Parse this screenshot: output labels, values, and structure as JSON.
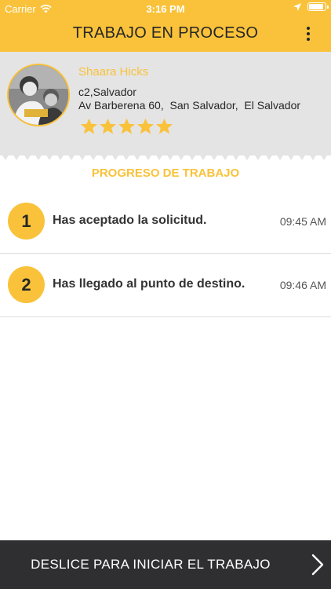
{
  "status_bar": {
    "carrier": "Carrier",
    "time": "3:16 PM"
  },
  "header": {
    "title": "TRABAJO EN PROCESO"
  },
  "profile": {
    "name": "Shaara Hicks",
    "line1": "c2,Salvador",
    "line2": "Av Barberena 60,  San Salvador,  El Salvador",
    "rating": 5
  },
  "progress": {
    "title": "PROGRESO DE TRABAJO",
    "steps": [
      {
        "number": "1",
        "text": "Has aceptado la solicitud.",
        "time": "09:45 AM"
      },
      {
        "number": "2",
        "text": "Has llegado al punto de destino.",
        "time": "09:46 AM"
      }
    ]
  },
  "slider": {
    "label": "DESLICE PARA INICIAR EL TRABAJO"
  },
  "colors": {
    "accent": "#f9c23a",
    "profile_bg": "#e4e4e4",
    "slider_bg": "#2f2f31"
  },
  "icons": [
    "wifi-icon",
    "location-arrow-icon",
    "battery-icon",
    "more-vertical-icon",
    "star-icon",
    "chevron-right-icon"
  ]
}
